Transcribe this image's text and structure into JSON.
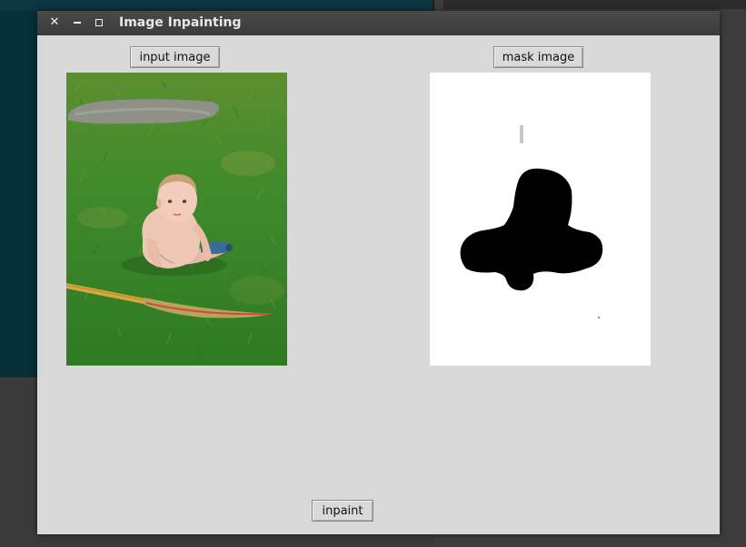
{
  "window": {
    "title": "Image Inpainting",
    "controls": {
      "close_glyph": "✕"
    }
  },
  "buttons": {
    "input_image": "input image",
    "mask_image": "mask image",
    "inpaint": "inpaint"
  },
  "colors": {
    "window_bg": "#d9d9d9",
    "titlebar_bg": "#3b3b3b",
    "grass": "#3f8a2c",
    "mask_fg": "#000000",
    "mask_bg": "#ffffff"
  }
}
